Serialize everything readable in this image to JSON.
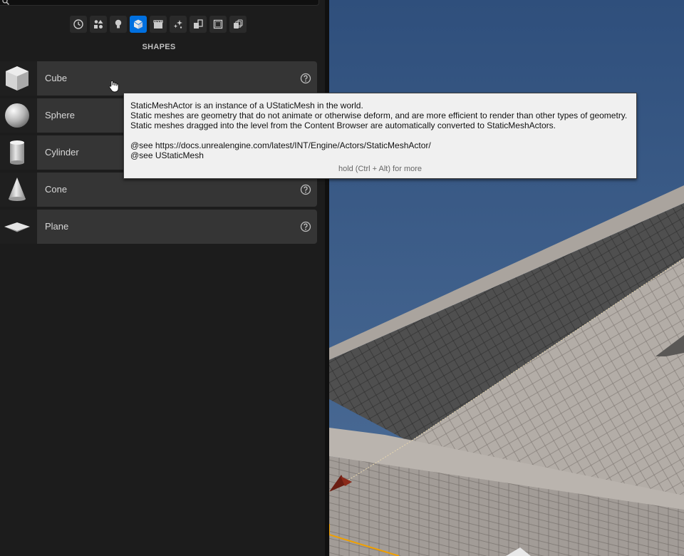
{
  "panel": {
    "section_title": "SHAPES",
    "category_icons": [
      "recent-clock-icon",
      "basic-actors-icon",
      "lights-bulb-icon",
      "shapes-cube-icon",
      "cinematic-clapper-icon",
      "visual-effects-sparkle-icon",
      "geometry-blocks-icon",
      "volumes-square-icon",
      "all-classes-stack-icon"
    ],
    "active_category": "shapes-cube-icon",
    "items": [
      {
        "label": "Cube"
      },
      {
        "label": "Sphere"
      },
      {
        "label": "Cylinder"
      },
      {
        "label": "Cone"
      },
      {
        "label": "Plane"
      }
    ]
  },
  "tooltip": {
    "line1": "StaticMeshActor is an instance of a UStaticMesh in the world.",
    "line2": "Static meshes are geometry that do not animate or otherwise deform, and are more efficient to render than other types of geometry.",
    "line3": "Static meshes dragged into the level from the Content Browser are automatically converted to StaticMeshActors.",
    "line4": "@see https://docs.unrealengine.com/latest/INT/Engine/Actors/StaticMeshActor/",
    "line5": "@see UStaticMesh",
    "more_hint": "hold (Ctrl + Alt) for more"
  },
  "colors": {
    "accent": "#0070e0",
    "panel_bg": "#1c1c1c",
    "item_bg": "#353535",
    "sky": "#3e5f8c",
    "floor": "#a8a29b"
  }
}
